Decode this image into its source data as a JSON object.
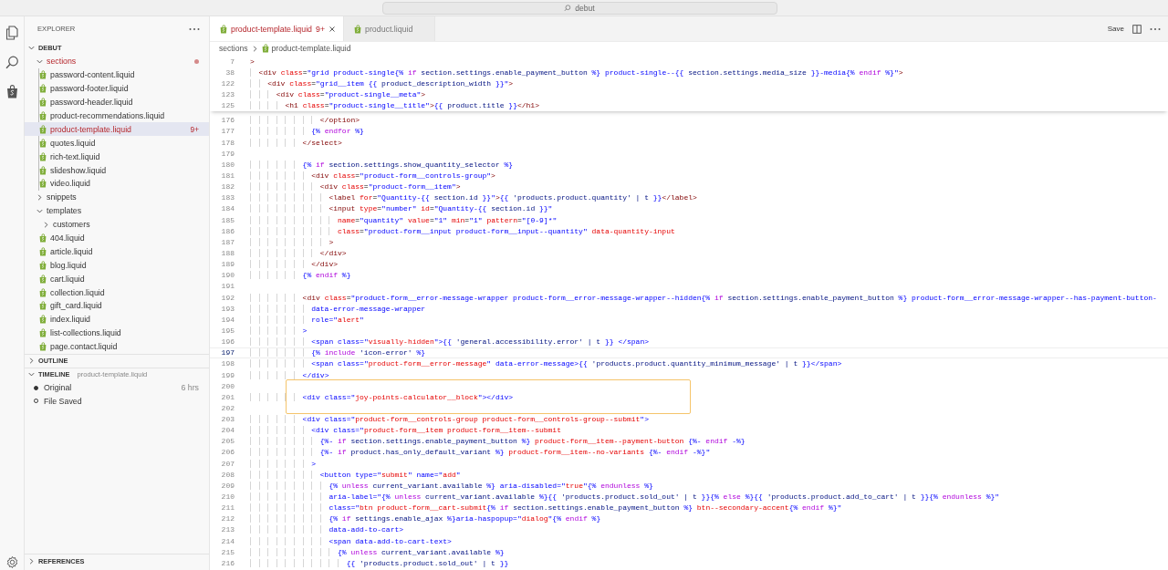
{
  "titlebar": {
    "search": "debut"
  },
  "explorer": {
    "title": "EXPLORER",
    "workspace": {
      "label": "DEBUT",
      "expanded": true
    },
    "tree": [
      {
        "label": "sections",
        "kind": "folder",
        "expanded": true,
        "error": true,
        "modified": true,
        "selected": false,
        "children": [
          {
            "label": "password-content.liquid",
            "kind": "file",
            "error": false,
            "selected": false
          },
          {
            "label": "password-footer.liquid",
            "kind": "file",
            "error": false,
            "selected": false
          },
          {
            "label": "password-header.liquid",
            "kind": "file",
            "error": false,
            "selected": false
          },
          {
            "label": "product-recommendations.liquid",
            "kind": "file",
            "error": false,
            "selected": false
          },
          {
            "label": "product-template.liquid",
            "kind": "file",
            "error": true,
            "selected": true,
            "badge": "9+"
          },
          {
            "label": "quotes.liquid",
            "kind": "file",
            "error": false,
            "selected": false
          },
          {
            "label": "rich-text.liquid",
            "kind": "file",
            "error": false,
            "selected": false
          },
          {
            "label": "slideshow.liquid",
            "kind": "file",
            "error": false,
            "selected": false
          },
          {
            "label": "video.liquid",
            "kind": "file",
            "error": false,
            "selected": false
          }
        ]
      },
      {
        "label": "snippets",
        "kind": "folder",
        "expanded": false,
        "error": false,
        "modified": false,
        "selected": false
      },
      {
        "label": "templates",
        "kind": "folder",
        "expanded": true,
        "error": false,
        "modified": false,
        "selected": false,
        "children": [
          {
            "label": "customers",
            "kind": "folder",
            "expanded": false,
            "error": false,
            "modified": false,
            "selected": false
          },
          {
            "label": "404.liquid",
            "kind": "file",
            "error": false,
            "selected": false
          },
          {
            "label": "article.liquid",
            "kind": "file",
            "error": false,
            "selected": false
          },
          {
            "label": "blog.liquid",
            "kind": "file",
            "error": false,
            "selected": false
          },
          {
            "label": "cart.liquid",
            "kind": "file",
            "error": false,
            "selected": false
          },
          {
            "label": "collection.liquid",
            "kind": "file",
            "error": false,
            "selected": false
          },
          {
            "label": "gift_card.liquid",
            "kind": "file",
            "error": false,
            "selected": false
          },
          {
            "label": "index.liquid",
            "kind": "file",
            "error": false,
            "selected": false
          },
          {
            "label": "list-collections.liquid",
            "kind": "file",
            "error": false,
            "selected": false
          },
          {
            "label": "page.contact.liquid",
            "kind": "file",
            "error": false,
            "selected": false
          }
        ]
      }
    ]
  },
  "outline": {
    "title": "OUTLINE",
    "expanded": false
  },
  "timeline": {
    "title": "TIMELINE",
    "subtitle": "product-template.liquid",
    "expanded": true,
    "items": [
      {
        "label": "Original",
        "time": "6 hrs",
        "selected": true
      },
      {
        "label": "File Saved",
        "selected": false
      }
    ]
  },
  "references": {
    "title": "REFERENCES",
    "expanded": false
  },
  "tabs": [
    {
      "label": "product-template.liquid",
      "badge": "9+",
      "selected": true,
      "error": true
    },
    {
      "label": "product.liquid",
      "selected": false,
      "error": false
    }
  ],
  "editor_actions": {
    "save": "Save"
  },
  "breadcrumb": [
    "sections",
    "product-template.liquid"
  ],
  "sticky_lines": [
    {
      "number": "7",
      "text": ">"
    },
    {
      "number": "38",
      "text": "  <div class=\"grid product-single{% if section.settings.enable_payment_button %} product-single--{{ section.settings.media_size }}-media{% endif %}\">"
    },
    {
      "number": "122",
      "text": "    <div class=\"grid__item {{ product_description_width }}\">"
    },
    {
      "number": "123",
      "text": "      <div class=\"product-single__meta\">"
    },
    {
      "number": "125",
      "text": "        <h1 class=\"product-single__title\">{{ product.title }}</h1>"
    }
  ],
  "code_lines": [
    {
      "kind": "line",
      "number": "176",
      "text": "                </option>",
      "current": false
    },
    {
      "kind": "line",
      "number": "177",
      "text": "              {% endfor %}",
      "current": false
    },
    {
      "kind": "line",
      "number": "178",
      "text": "            </select>",
      "current": false
    },
    {
      "kind": "line",
      "number": "179",
      "current": false
    },
    {
      "kind": "line",
      "number": "180",
      "text": "            {% if section.settings.show_quantity_selector %}",
      "current": false
    },
    {
      "kind": "line",
      "number": "181",
      "text": "              <div class=\"product-form__controls-group\">",
      "current": false
    },
    {
      "kind": "line",
      "number": "182",
      "text": "                <div class=\"product-form__item\">",
      "current": false
    },
    {
      "kind": "line",
      "number": "183",
      "text": "                  <label for=\"Quantity-{{ section.id }}\">{{ 'products.product.quantity' | t }}</label>",
      "current": false
    },
    {
      "kind": "line",
      "number": "184",
      "text": "                  <input type=\"number\" id=\"Quantity-{{ section.id }}\"",
      "current": false
    },
    {
      "kind": "line",
      "number": "185",
      "text": "                    name=\"quantity\" value=\"1\" min=\"1\" pattern=\"[0-9]*\"",
      "current": false
    },
    {
      "kind": "line",
      "number": "186",
      "text": "                    class=\"product-form__input product-form__input--quantity\" data-quantity-input",
      "current": false
    },
    {
      "kind": "line",
      "number": "187",
      "text": "                  >",
      "current": false
    },
    {
      "kind": "line",
      "number": "188",
      "text": "                </div>",
      "current": false
    },
    {
      "kind": "line",
      "number": "189",
      "text": "              </div>",
      "current": false
    },
    {
      "kind": "line",
      "number": "190",
      "text": "            {% endif %}",
      "current": false
    },
    {
      "kind": "line",
      "number": "191",
      "current": false
    },
    {
      "kind": "line",
      "number": "192",
      "text": "            <div class=\"product-form__error-message-wrapper product-form__error-message-wrapper--hidden{% if section.settings.enable_payment_button %} product-form__error-message-wrapper--has-payment-button-",
      "current": false
    },
    {
      "kind": "line",
      "number": "193",
      "text": "              data-error-message-wrapper",
      "current": false
    },
    {
      "kind": "line",
      "number": "194",
      "text": "              role=\"alert\"",
      "current": false
    },
    {
      "kind": "line",
      "number": "195",
      "text": "            >",
      "current": false
    },
    {
      "kind": "line",
      "number": "196",
      "text": "              <span class=\"visually-hidden\">{{ 'general.accessibility.error' | t }} </span>",
      "current": false
    },
    {
      "kind": "line",
      "number": "197",
      "text": "              {% include 'icon-error' %}",
      "current": true
    },
    {
      "kind": "line",
      "number": "198",
      "text": "              <span class=\"product-form__error-message\" data-error-message>{{ 'products.product.quantity_minimum_message' | t }}</span>",
      "current": false
    },
    {
      "kind": "line",
      "number": "199",
      "text": "            </div>",
      "current": false
    },
    {
      "kind": "highlight",
      "lines": [
        {
          "number": "200",
          "current": false
        },
        {
          "number": "201",
          "text": "            <div class=\"joy-points-calculator__block\"></div>",
          "current": false
        },
        {
          "number": "202",
          "current": false
        }
      ]
    },
    {
      "kind": "line",
      "number": "203",
      "text": "            <div class=\"product-form__controls-group product-form__controls-group--submit\">",
      "current": false
    },
    {
      "kind": "line",
      "number": "204",
      "text": "              <div class=\"product-form__item product-form__item--submit",
      "current": false
    },
    {
      "kind": "line",
      "number": "205",
      "text": "                {%- if section.settings.enable_payment_button %} product-form__item--payment-button {%- endif -%}",
      "current": false
    },
    {
      "kind": "line",
      "number": "206",
      "text": "                {%- if product.has_only_default_variant %} product-form__item--no-variants {%- endif -%}\"",
      "current": false
    },
    {
      "kind": "line",
      "number": "207",
      "text": "              >",
      "current": false
    },
    {
      "kind": "line",
      "number": "208",
      "text": "                <button type=\"submit\" name=\"add\"",
      "current": false
    },
    {
      "kind": "line",
      "number": "209",
      "text": "                  {% unless current_variant.available %} aria-disabled=\"true\"{% endunless %}",
      "current": false
    },
    {
      "kind": "line",
      "number": "210",
      "text": "                  aria-label=\"{% unless current_variant.available %}{{ 'products.product.sold_out' | t }}{% else %}{{ 'products.product.add_to_cart' | t }}{% endunless %}\"",
      "current": false
    },
    {
      "kind": "line",
      "number": "211",
      "text": "                  class=\"btn product-form__cart-submit{% if section.settings.enable_payment_button %} btn--secondary-accent{% endif %}\"",
      "current": false
    },
    {
      "kind": "line",
      "number": "212",
      "text": "                  {% if settings.enable_ajax %}aria-haspopup=\"dialog\"{% endif %}",
      "current": false
    },
    {
      "kind": "line",
      "number": "213",
      "text": "                  data-add-to-cart>",
      "current": false
    },
    {
      "kind": "line",
      "number": "214",
      "text": "                  <span data-add-to-cart-text>",
      "current": false
    },
    {
      "kind": "line",
      "number": "215",
      "text": "                    {% unless current_variant.available %}",
      "current": false
    },
    {
      "kind": "line",
      "number": "216",
      "text": "                      {{ 'products.product.sold_out' | t }}",
      "current": false
    }
  ]
}
